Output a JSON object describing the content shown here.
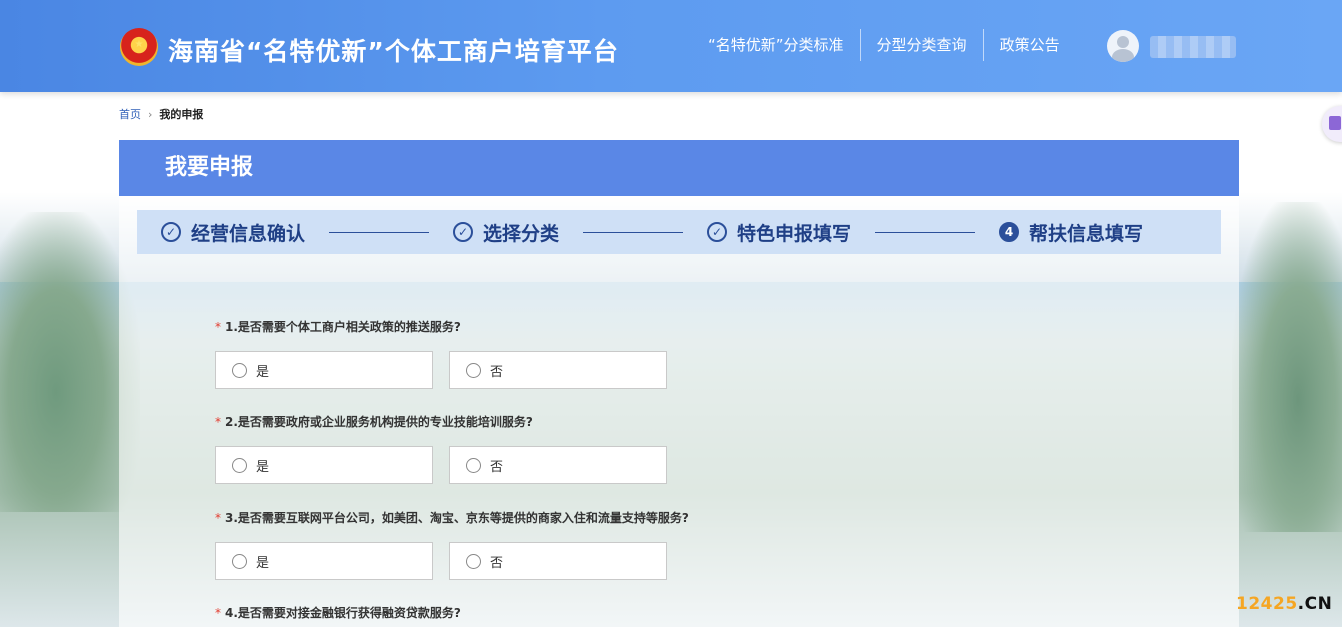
{
  "header": {
    "title": "海南省“名特优新”个体工商户培育平台",
    "nav": [
      "“名特优新”分类标准",
      "分型分类查询",
      "政策公告"
    ]
  },
  "breadcrumb": {
    "home": "首页",
    "separator": "›",
    "current": "我的申报"
  },
  "panel": {
    "title": "我要申报"
  },
  "steps": [
    {
      "label": "经营信息确认",
      "state": "done",
      "icon": "check-circle-icon"
    },
    {
      "label": "选择分类",
      "state": "done",
      "icon": "check-circle-icon"
    },
    {
      "label": "特色申报填写",
      "state": "done",
      "icon": "check-circle-icon"
    },
    {
      "label": "帮扶信息填写",
      "state": "current",
      "number": "4"
    }
  ],
  "questions": [
    {
      "required": "*",
      "text": "1.是否需要个体工商户相关政策的推送服务?",
      "yes": "是",
      "no": "否"
    },
    {
      "required": "*",
      "text": "2.是否需要政府或企业服务机构提供的专业技能培训服务?",
      "yes": "是",
      "no": "否"
    },
    {
      "required": "*",
      "text": "3.是否需要互联网平台公司，如美团、淘宝、京东等提供的商家入住和流量支持等服务?",
      "yes": "是",
      "no": "否"
    },
    {
      "required": "*",
      "text": "4.是否需要对接金融银行获得融资贷款服务?"
    }
  ],
  "watermark": {
    "number": "12425",
    "suffix": ".CN"
  },
  "colors": {
    "header": "#4a86e3",
    "panel_head": "#5a87e6",
    "step_bar": "#cfe0f6",
    "step_text": "#1f3f86",
    "required": "#e23b2f"
  }
}
